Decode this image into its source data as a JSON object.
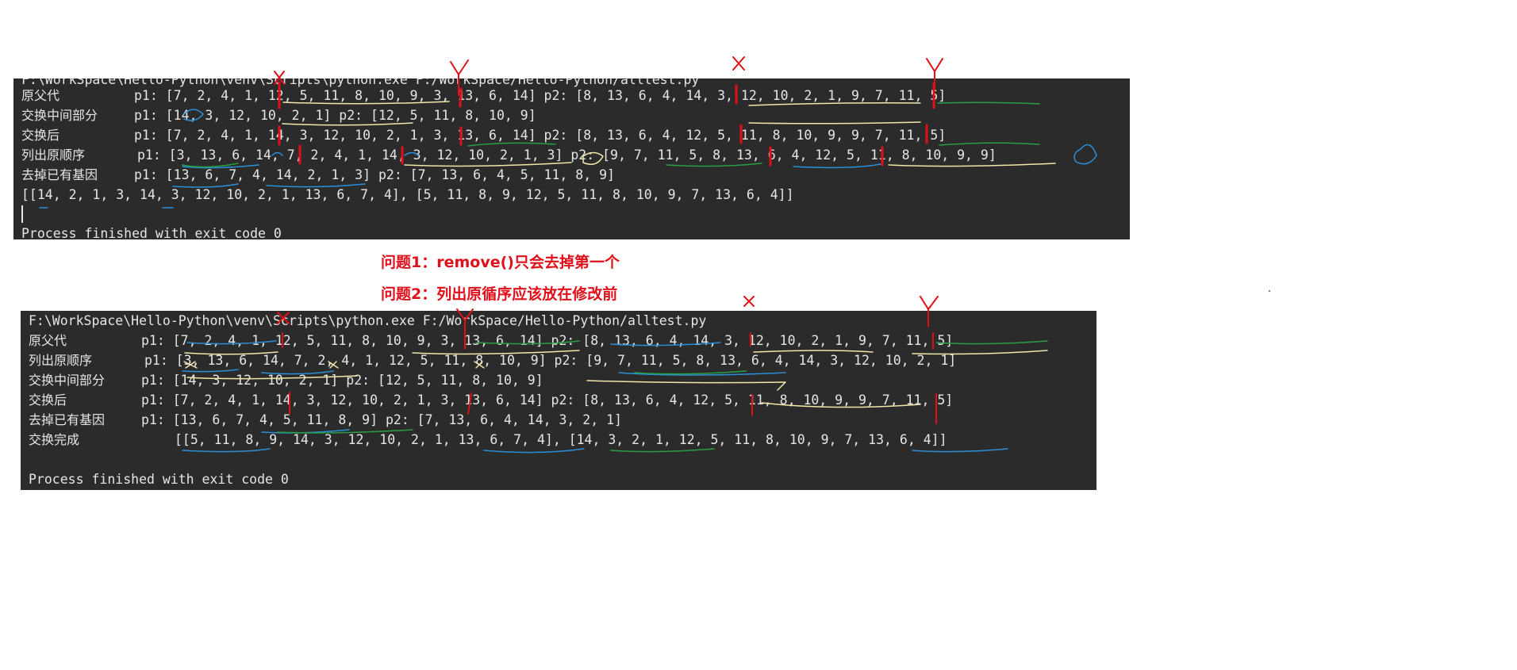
{
  "top_console": {
    "header_partial": "F:\\WorkSpace\\Hello-Python\\venv\\Scripts\\python.exe F:/WorkSpace/Hello-Python/alltest.py",
    "lines": [
      {
        "label": "原父代",
        "text": "p1: [7, 2, 4, 1, 12, 5, 11, 8, 10, 9, 3, 13, 6, 14] p2: [8, 13, 6, 4, 14, 3, 12, 10, 2, 1, 9, 7, 11, 5]"
      },
      {
        "label": "交换中间部分",
        "text": "p1: [14, 3, 12, 10, 2, 1] p2: [12, 5, 11, 8, 10, 9]"
      },
      {
        "label": "交换后",
        "text": "p1: [7, 2, 4, 1, 14, 3, 12, 10, 2, 1, 3, 13, 6, 14] p2: [8, 13, 6, 4, 12, 5, 11, 8, 10, 9, 9, 7, 11, 5]"
      },
      {
        "label": "列出原顺序",
        "text": "p1: [3, 13, 6, 14, 7, 2, 4, 1, 14, 3, 12, 10, 2, 1, 3] p2: [9, 7, 11, 5, 8, 13, 6, 4, 12, 5, 11, 8, 10, 9, 9]"
      },
      {
        "label": "去掉已有基因",
        "text": "p1: [13, 6, 7, 4, 14, 2, 1, 3] p2: [7, 13, 6, 4, 5, 11, 8, 9]"
      },
      {
        "label": "",
        "text": "[[14, 2, 1, 3, 14, 3, 12, 10, 2, 1, 13, 6, 7, 4], [5, 11, 8, 9, 12, 5, 11, 8, 10, 9, 7, 13, 6, 4]]"
      }
    ],
    "exit_message": "Process finished with exit code 0"
  },
  "notes": {
    "note1": "问题1：remove()只会去掉第一个",
    "note2": "问题2：列出原循序应该放在修改前"
  },
  "bottom_console": {
    "header": "F:\\WorkSpace\\Hello-Python\\venv\\Scripts\\python.exe F:/WorkSpace/Hello-Python/alltest.py",
    "lines": [
      {
        "label": "原父代",
        "text": "p1: [7, 2, 4, 1, 12, 5, 11, 8, 10, 9, 3, 13, 6, 14] p2: [8, 13, 6, 4, 14, 3, 12, 10, 2, 1, 9, 7, 11, 5]"
      },
      {
        "label": "列出原顺序",
        "text": "p1: [3, 13, 6, 14, 7, 2, 4, 1, 12, 5, 11, 8, 10, 9] p2: [9, 7, 11, 5, 8, 13, 6, 4, 14, 3, 12, 10, 2, 1]"
      },
      {
        "label": "交换中间部分",
        "text": "p1: [14, 3, 12, 10, 2, 1] p2: [12, 5, 11, 8, 10, 9]"
      },
      {
        "label": "交换后",
        "text": "p1: [7, 2, 4, 1, 14, 3, 12, 10, 2, 1, 3, 13, 6, 14] p2: [8, 13, 6, 4, 12, 5, 11, 8, 10, 9, 9, 7, 11, 5]"
      },
      {
        "label": "去掉已有基因",
        "text": "p1: [13, 6, 7, 4, 5, 11, 8, 9] p2: [7, 13, 6, 4, 14, 3, 2, 1]"
      },
      {
        "label": "交换完成",
        "text": "[[5, 11, 8, 9, 14, 3, 12, 10, 2, 1, 13, 6, 7, 4], [14, 3, 2, 1, 12, 5, 11, 8, 10, 9, 7, 13, 6, 4]]"
      }
    ],
    "exit_message": "Process finished with exit code 0"
  },
  "colors": {
    "console_bg": "#2b2b2b",
    "console_text": "#e6e6e6",
    "note_red": "#e0101a",
    "mark_red": "#e0101a",
    "mark_yellow": "#f2e6a8",
    "mark_blue": "#2a8fd8",
    "mark_green": "#27a043"
  },
  "handwritten_marks": {
    "top_console": [
      "X",
      "Y",
      "X",
      "Y"
    ],
    "bottom_console": [
      "X",
      "Y",
      "X",
      "Y"
    ]
  }
}
